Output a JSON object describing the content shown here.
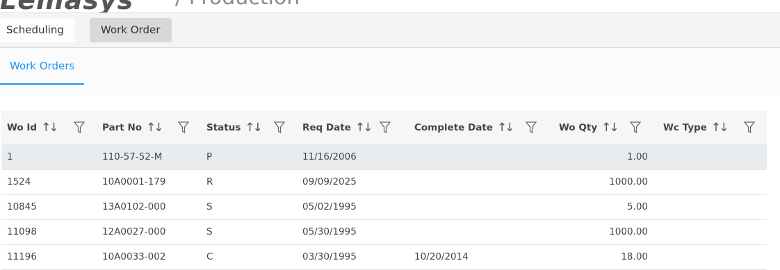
{
  "header": {
    "logo": "Lemasys",
    "breadcrumb": "/ Production"
  },
  "menu": {
    "items": [
      {
        "label": "Scheduling"
      },
      {
        "label": "Work Order"
      }
    ]
  },
  "tabs": [
    {
      "label": "Work Orders"
    }
  ],
  "grid": {
    "columns": [
      {
        "label": "Wo Id"
      },
      {
        "label": "Part No"
      },
      {
        "label": "Status"
      },
      {
        "label": "Req Date"
      },
      {
        "label": "Complete Date"
      },
      {
        "label": "Wo Qty"
      },
      {
        "label": "Wc Type"
      }
    ],
    "sort_glyph": "↑↓",
    "rows": [
      {
        "wo_id": "1",
        "part_no": "110-57-52-M",
        "status": "P",
        "req_date": "11/16/2006",
        "complete_date": "",
        "wo_qty": "1.00",
        "wc_type": ""
      },
      {
        "wo_id": "1524",
        "part_no": "10A0001-179",
        "status": "R",
        "req_date": "09/09/2025",
        "complete_date": "",
        "wo_qty": "1000.00",
        "wc_type": ""
      },
      {
        "wo_id": "10845",
        "part_no": "13A0102-000",
        "status": "S",
        "req_date": "05/02/1995",
        "complete_date": "",
        "wo_qty": "5.00",
        "wc_type": ""
      },
      {
        "wo_id": "11098",
        "part_no": "12A0027-000",
        "status": "S",
        "req_date": "05/30/1995",
        "complete_date": "",
        "wo_qty": "1000.00",
        "wc_type": ""
      },
      {
        "wo_id": "11196",
        "part_no": "10A0033-002",
        "status": "C",
        "req_date": "03/30/1995",
        "complete_date": "10/20/2014",
        "wo_qty": "18.00",
        "wc_type": ""
      }
    ]
  }
}
